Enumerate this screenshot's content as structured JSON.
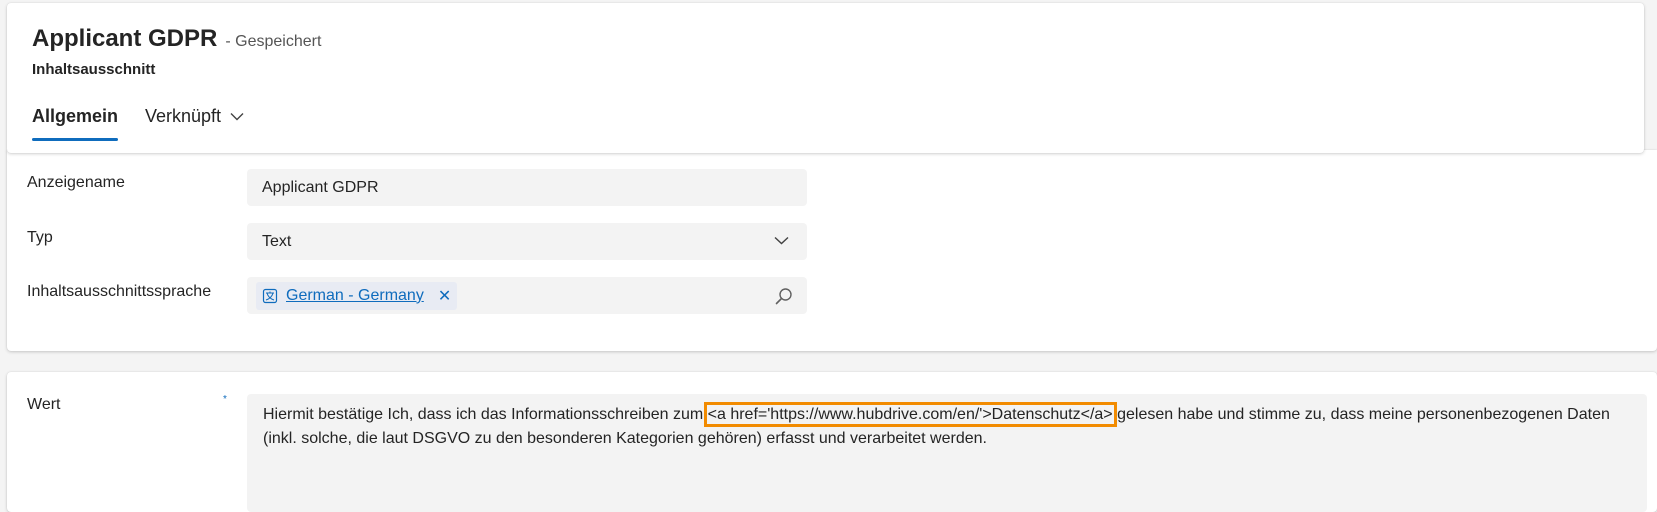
{
  "header": {
    "title": "Applicant GDPR",
    "status": "- Gespeichert",
    "entity_type": "Inhaltsausschnitt",
    "tabs": [
      {
        "label": "Allgemein",
        "active": true
      },
      {
        "label": "Verknüpft",
        "active": false
      }
    ]
  },
  "fields": {
    "display_name": {
      "label": "Anzeigename",
      "value": "Applicant GDPR"
    },
    "type": {
      "label": "Typ",
      "value": "Text"
    },
    "language": {
      "label": "Inhaltsausschnittssprache",
      "value": "German - Germany"
    }
  },
  "value_field": {
    "label": "Wert",
    "required_marker": "*",
    "text_before": "Hiermit bestätige Ich, dass ich das Informationsschreiben zum ",
    "text_highlight": "<a href='https://www.hubdrive.com/en/'>Datenschutz</a>",
    "text_after": " gelesen habe und stimme zu, dass meine personenbezogenen Daten (inkl. solche, die laut DSGVO zu den besonderen Kategorien gehören) erfasst und verarbeitet werden."
  },
  "colors": {
    "accent": "#0f6cbd",
    "highlight_border": "#f28b00"
  },
  "icons": [
    "chevron-down-icon",
    "language-entity-icon",
    "close-icon",
    "search-icon"
  ]
}
